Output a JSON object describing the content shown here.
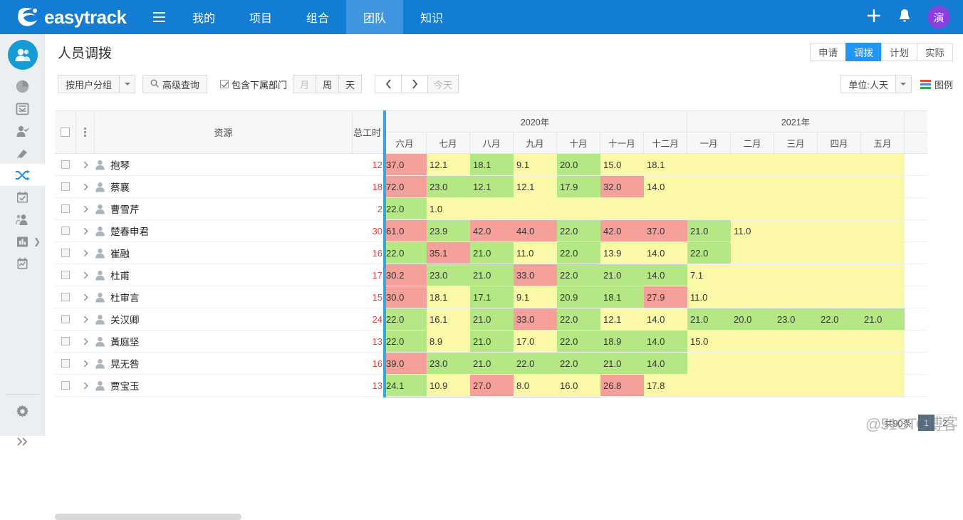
{
  "topnav": {
    "brand": "easytrack",
    "menu_icon": "hamburger-icon",
    "items": [
      {
        "label": "我的",
        "active": false
      },
      {
        "label": "项目",
        "active": false
      },
      {
        "label": "组合",
        "active": false
      },
      {
        "label": "团队",
        "active": true
      },
      {
        "label": "知识",
        "active": false
      }
    ],
    "add_label": "+",
    "bell_label": "⬤",
    "avatar_text": "演",
    "bg_color": "#137cd3",
    "active_color": "#3f96e0",
    "avatar_color": "#8a3fe0"
  },
  "leftrail": {
    "items": [
      {
        "name": "user-group-icon",
        "active": true
      },
      {
        "name": "pie-chart-icon",
        "active": false
      },
      {
        "name": "inbox-icon",
        "active": false
      },
      {
        "name": "person-check-icon",
        "active": false
      },
      {
        "name": "rocket-icon",
        "active": false
      },
      {
        "name": "shuffle-icon",
        "active": true
      },
      {
        "name": "calendar-check-icon",
        "active": false
      },
      {
        "name": "people-group-icon",
        "active": false
      },
      {
        "name": "bar-chart-icon",
        "active": false
      },
      {
        "name": "clipboard-chart-icon",
        "active": false
      }
    ],
    "settings_icon": "gear-icon",
    "expand_icon": "double-chevron-right-icon"
  },
  "page": {
    "title": "人员调拨",
    "view_tabs": [
      {
        "label": "申请",
        "active": false
      },
      {
        "label": "调拨",
        "active": true
      },
      {
        "label": "计划",
        "active": false
      },
      {
        "label": "实际",
        "active": false
      }
    ]
  },
  "toolbar": {
    "group_by": "按用户分组",
    "group_caret": "chevron-down-icon",
    "advanced_search": "高级查询",
    "search_icon": "search-icon",
    "include_sub_depts": {
      "label": "包含下属部门",
      "checked": true
    },
    "scales": [
      {
        "label": "月",
        "active": false,
        "dim": true
      },
      {
        "label": "周",
        "active": false,
        "dim": false
      },
      {
        "label": "天",
        "active": false,
        "dim": false
      }
    ],
    "prev_icon": "chevron-left-icon",
    "next_icon": "chevron-right-icon",
    "today": "今天",
    "unit": "单位:人天",
    "unit_caret": "chevron-down-icon",
    "legend": "图例",
    "legend_icon": "legend-icon",
    "legend_colors": [
      "#e8453c",
      "#4285f4",
      "#34a853"
    ]
  },
  "grid": {
    "columns": {
      "resource": "资源",
      "total": "总工时"
    },
    "years": [
      {
        "label": "2020年",
        "span": 7
      },
      {
        "label": "2021年",
        "span": 5
      }
    ],
    "months": [
      "六月",
      "七月",
      "八月",
      "九月",
      "十月",
      "十一月",
      "十二月",
      "一月",
      "二月",
      "三月",
      "四月",
      "五月"
    ],
    "rows": [
      {
        "name": "抱琴",
        "total": "12",
        "cells": [
          {
            "v": "37.0",
            "c": "red"
          },
          {
            "v": "12.1",
            "c": "yellow"
          },
          {
            "v": "18.1",
            "c": "green"
          },
          {
            "v": "9.1",
            "c": "yellow"
          },
          {
            "v": "20.0",
            "c": "green"
          },
          {
            "v": "15.0",
            "c": "yellow"
          },
          {
            "v": "18.1",
            "c": "yellow"
          },
          {
            "v": "",
            "c": "yellow"
          },
          {
            "v": "",
            "c": "yellow"
          },
          {
            "v": "",
            "c": "yellow"
          },
          {
            "v": "",
            "c": "yellow"
          },
          {
            "v": "",
            "c": "yellow"
          }
        ]
      },
      {
        "name": "蔡襄",
        "total": "18",
        "cells": [
          {
            "v": "72.0",
            "c": "red"
          },
          {
            "v": "23.0",
            "c": "green"
          },
          {
            "v": "12.1",
            "c": "green"
          },
          {
            "v": "12.1",
            "c": "yellow"
          },
          {
            "v": "17.9",
            "c": "green"
          },
          {
            "v": "32.0",
            "c": "red"
          },
          {
            "v": "14.0",
            "c": "yellow"
          },
          {
            "v": "",
            "c": "yellow"
          },
          {
            "v": "",
            "c": "yellow"
          },
          {
            "v": "",
            "c": "yellow"
          },
          {
            "v": "",
            "c": "yellow"
          },
          {
            "v": "",
            "c": "yellow"
          }
        ]
      },
      {
        "name": "曹雪芹",
        "total": "2",
        "cells": [
          {
            "v": "22.0",
            "c": "green"
          },
          {
            "v": "1.0",
            "c": "yellow"
          },
          {
            "v": "",
            "c": "yellow"
          },
          {
            "v": "",
            "c": "yellow"
          },
          {
            "v": "",
            "c": "yellow"
          },
          {
            "v": "",
            "c": "yellow"
          },
          {
            "v": "",
            "c": "yellow"
          },
          {
            "v": "",
            "c": "yellow"
          },
          {
            "v": "",
            "c": "yellow"
          },
          {
            "v": "",
            "c": "yellow"
          },
          {
            "v": "",
            "c": "yellow"
          },
          {
            "v": "",
            "c": "yellow"
          }
        ]
      },
      {
        "name": "楚春申君",
        "total": "30",
        "cells": [
          {
            "v": "61.0",
            "c": "red"
          },
          {
            "v": "23.9",
            "c": "green"
          },
          {
            "v": "42.0",
            "c": "red"
          },
          {
            "v": "44.0",
            "c": "red"
          },
          {
            "v": "22.0",
            "c": "green"
          },
          {
            "v": "42.0",
            "c": "red"
          },
          {
            "v": "37.0",
            "c": "red"
          },
          {
            "v": "21.0",
            "c": "green"
          },
          {
            "v": "11.0",
            "c": "yellow"
          },
          {
            "v": "",
            "c": "yellow"
          },
          {
            "v": "",
            "c": "yellow"
          },
          {
            "v": "",
            "c": "yellow"
          }
        ]
      },
      {
        "name": "崔融",
        "total": "16",
        "cells": [
          {
            "v": "22.0",
            "c": "green"
          },
          {
            "v": "35.1",
            "c": "red"
          },
          {
            "v": "21.0",
            "c": "green"
          },
          {
            "v": "11.0",
            "c": "yellow"
          },
          {
            "v": "22.0",
            "c": "green"
          },
          {
            "v": "13.9",
            "c": "yellow"
          },
          {
            "v": "14.0",
            "c": "yellow"
          },
          {
            "v": "22.0",
            "c": "green"
          },
          {
            "v": "",
            "c": "yellow"
          },
          {
            "v": "",
            "c": "yellow"
          },
          {
            "v": "",
            "c": "yellow"
          },
          {
            "v": "",
            "c": "yellow"
          }
        ]
      },
      {
        "name": "杜甫",
        "total": "17",
        "cells": [
          {
            "v": "30.2",
            "c": "red"
          },
          {
            "v": "23.0",
            "c": "green"
          },
          {
            "v": "21.0",
            "c": "green"
          },
          {
            "v": "33.0",
            "c": "red"
          },
          {
            "v": "22.0",
            "c": "green"
          },
          {
            "v": "21.0",
            "c": "green"
          },
          {
            "v": "14.0",
            "c": "green"
          },
          {
            "v": "7.1",
            "c": "yellow"
          },
          {
            "v": "",
            "c": "yellow"
          },
          {
            "v": "",
            "c": "yellow"
          },
          {
            "v": "",
            "c": "yellow"
          },
          {
            "v": "",
            "c": "yellow"
          }
        ]
      },
      {
        "name": "杜审言",
        "total": "15",
        "cells": [
          {
            "v": "30.0",
            "c": "red"
          },
          {
            "v": "18.1",
            "c": "yellow"
          },
          {
            "v": "17.1",
            "c": "green"
          },
          {
            "v": "9.1",
            "c": "yellow"
          },
          {
            "v": "20.9",
            "c": "green"
          },
          {
            "v": "18.1",
            "c": "green"
          },
          {
            "v": "27.9",
            "c": "red"
          },
          {
            "v": "11.0",
            "c": "yellow"
          },
          {
            "v": "",
            "c": "yellow"
          },
          {
            "v": "",
            "c": "yellow"
          },
          {
            "v": "",
            "c": "yellow"
          },
          {
            "v": "",
            "c": "yellow"
          }
        ]
      },
      {
        "name": "关汉卿",
        "total": "24",
        "cells": [
          {
            "v": "22.0",
            "c": "green"
          },
          {
            "v": "16.1",
            "c": "yellow"
          },
          {
            "v": "21.0",
            "c": "green"
          },
          {
            "v": "33.0",
            "c": "red"
          },
          {
            "v": "22.0",
            "c": "green"
          },
          {
            "v": "12.1",
            "c": "yellow"
          },
          {
            "v": "14.0",
            "c": "yellow"
          },
          {
            "v": "21.0",
            "c": "green"
          },
          {
            "v": "20.0",
            "c": "green"
          },
          {
            "v": "23.0",
            "c": "green"
          },
          {
            "v": "22.0",
            "c": "green"
          },
          {
            "v": "21.0",
            "c": "green"
          }
        ]
      },
      {
        "name": "黃庭坚",
        "total": "13",
        "cells": [
          {
            "v": "22.0",
            "c": "green"
          },
          {
            "v": "8.9",
            "c": "yellow"
          },
          {
            "v": "21.0",
            "c": "green"
          },
          {
            "v": "17.0",
            "c": "yellow"
          },
          {
            "v": "22.0",
            "c": "green"
          },
          {
            "v": "18.9",
            "c": "green"
          },
          {
            "v": "14.0",
            "c": "green"
          },
          {
            "v": "15.0",
            "c": "yellow"
          },
          {
            "v": "",
            "c": "yellow"
          },
          {
            "v": "",
            "c": "yellow"
          },
          {
            "v": "",
            "c": "yellow"
          },
          {
            "v": "",
            "c": "yellow"
          }
        ]
      },
      {
        "name": "晃无咎",
        "total": "16",
        "cells": [
          {
            "v": "39.0",
            "c": "red"
          },
          {
            "v": "23.0",
            "c": "green"
          },
          {
            "v": "21.0",
            "c": "green"
          },
          {
            "v": "22.0",
            "c": "green"
          },
          {
            "v": "22.0",
            "c": "green"
          },
          {
            "v": "21.0",
            "c": "green"
          },
          {
            "v": "14.0",
            "c": "green"
          },
          {
            "v": "",
            "c": "yellow"
          },
          {
            "v": "",
            "c": "yellow"
          },
          {
            "v": "",
            "c": "yellow"
          },
          {
            "v": "",
            "c": "yellow"
          },
          {
            "v": "",
            "c": "yellow"
          }
        ]
      },
      {
        "name": "贾宝玉",
        "total": "13",
        "cells": [
          {
            "v": "24.1",
            "c": "green"
          },
          {
            "v": "10.9",
            "c": "yellow"
          },
          {
            "v": "27.0",
            "c": "red"
          },
          {
            "v": "8.0",
            "c": "yellow"
          },
          {
            "v": "16.0",
            "c": "yellow"
          },
          {
            "v": "26.8",
            "c": "red"
          },
          {
            "v": "17.8",
            "c": "yellow"
          },
          {
            "v": "",
            "c": "yellow"
          },
          {
            "v": "",
            "c": "yellow"
          },
          {
            "v": "",
            "c": "yellow"
          },
          {
            "v": "",
            "c": "yellow"
          },
          {
            "v": "",
            "c": "yellow"
          }
        ]
      },
      {
        "name": "",
        "total": "",
        "cells": [
          {
            "v": "",
            "c": "red"
          },
          {
            "v": "",
            "c": "green"
          },
          {
            "v": "",
            "c": "yellow"
          },
          {
            "v": "",
            "c": "green"
          },
          {
            "v": "",
            "c": "green"
          },
          {
            "v": "",
            "c": "yellow"
          },
          {
            "v": "",
            "c": "yellow"
          },
          {
            "v": "",
            "c": "yellow"
          },
          {
            "v": "",
            "c": "yellow"
          },
          {
            "v": "",
            "c": "yellow"
          },
          {
            "v": "",
            "c": "yellow"
          },
          {
            "v": "",
            "c": "yellow"
          }
        ]
      }
    ],
    "colors": {
      "red": "#f5a09a",
      "green": "#b5e884",
      "yellow": "#fbf8a8",
      "divider": "#3aa5dc"
    }
  },
  "footer": {
    "total_text": "共90条",
    "page_current": "1",
    "page_next": "2",
    "watermark": "@51CTO博客"
  }
}
